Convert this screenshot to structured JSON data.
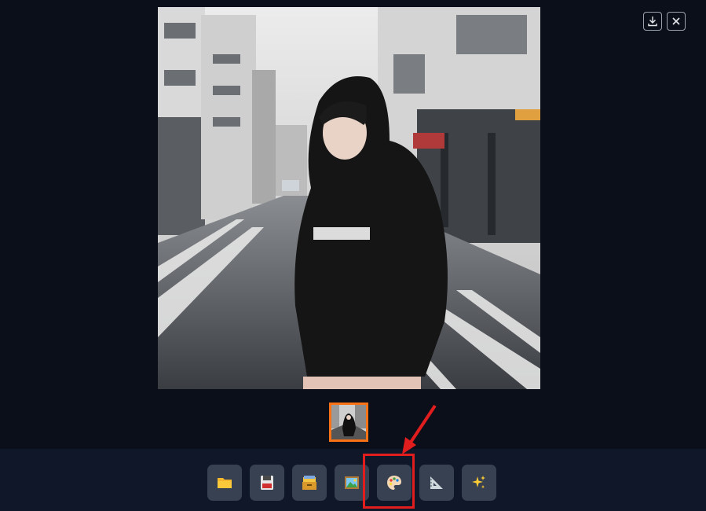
{
  "lightbox": {
    "download_button": "download",
    "close_button": "close",
    "main_image_alt": "photo",
    "thumbnail_alt": "thumbnail"
  },
  "toolbar": {
    "buttons": [
      {
        "icon": "folder-icon",
        "emoji": "📁"
      },
      {
        "icon": "save-icon",
        "emoji": "💾"
      },
      {
        "icon": "card-file-box-icon",
        "emoji": "🗂"
      },
      {
        "icon": "framed-picture-icon",
        "emoji": "🖼"
      },
      {
        "icon": "palette-icon",
        "emoji": "🎨"
      },
      {
        "icon": "triangular-ruler-icon",
        "emoji": "📐"
      },
      {
        "icon": "sparkles-icon",
        "emoji": "✨"
      }
    ]
  },
  "annotation": {
    "highlight_color": "#e11d1d",
    "highlighted_button": "palette-icon"
  },
  "colors": {
    "background": "#0b0f19",
    "button_bg": "#374151",
    "thumb_border": "#f97316"
  }
}
